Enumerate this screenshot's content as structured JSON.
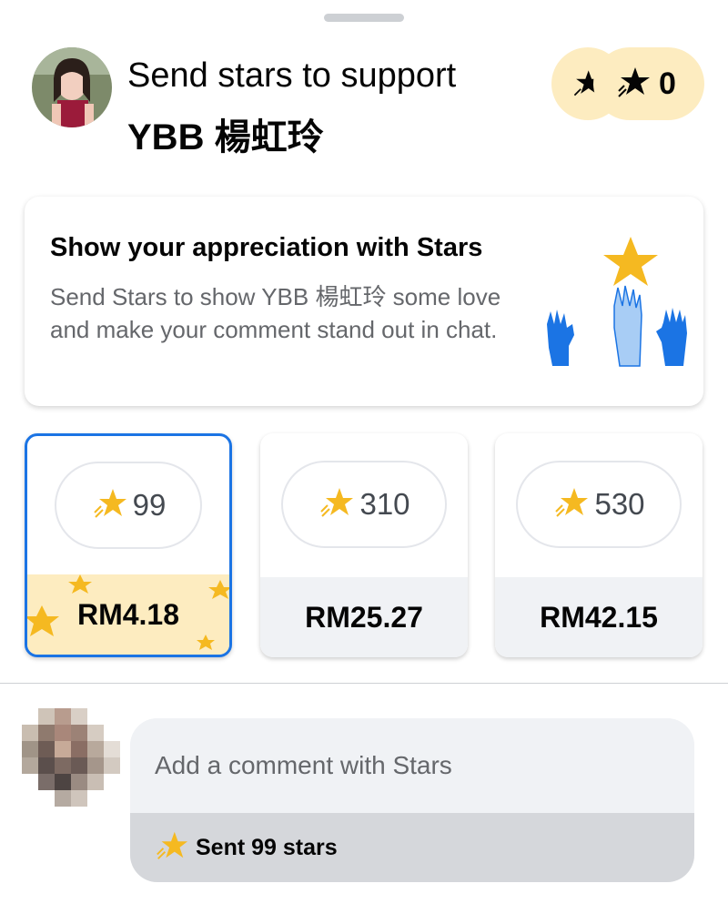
{
  "header": {
    "line1": "Send stars to support",
    "creator_name": "YBB 楊虹玲",
    "avatar_icon": "creator-avatar"
  },
  "balance": {
    "count": "0",
    "icon": "star-icon"
  },
  "info_card": {
    "title": "Show your appreciation with Stars",
    "description": "Send Stars to show YBB 楊虹玲 some love and make your comment stand out in chat.",
    "illustration": "raised-hands-star-illustration"
  },
  "tiers": [
    {
      "stars": "99",
      "price": "RM4.18",
      "selected": true
    },
    {
      "stars": "310",
      "price": "RM25.27",
      "selected": false
    },
    {
      "stars": "530",
      "price": "RM42.15",
      "selected": false
    }
  ],
  "comment": {
    "placeholder": "Add a comment with Stars",
    "sent_label": "Sent 99 stars"
  },
  "colors": {
    "accent_blue": "#1b74e4",
    "star_yellow": "#f5b921",
    "pill_cream": "#fdecc0",
    "muted_text": "#65676b",
    "band_gray": "#f0f2f5"
  }
}
